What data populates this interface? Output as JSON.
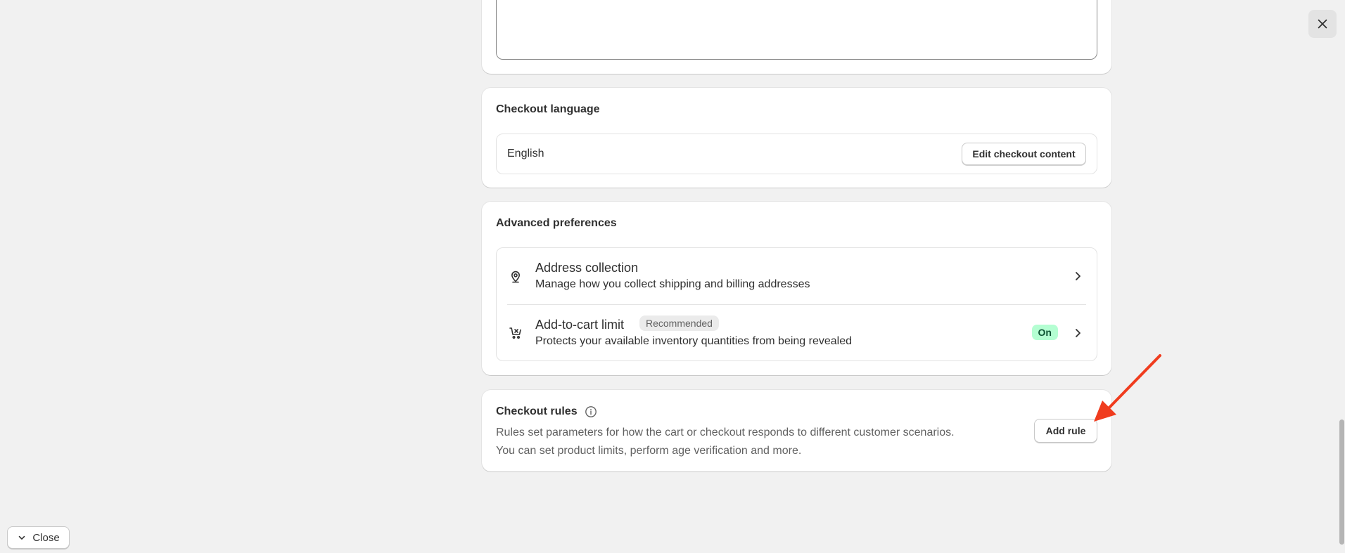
{
  "checkout_language": {
    "title": "Checkout language",
    "value": "English",
    "edit_button_label": "Edit checkout content"
  },
  "advanced_preferences": {
    "title": "Advanced preferences",
    "items": [
      {
        "icon": "location-pin-icon",
        "title": "Address collection",
        "description": "Manage how you collect shipping and billing addresses"
      },
      {
        "icon": "cart-limit-icon",
        "title": "Add-to-cart limit",
        "badge": "Recommended",
        "status": "On",
        "description": "Protects your available inventory quantities from being revealed"
      }
    ]
  },
  "checkout_rules": {
    "title": "Checkout rules",
    "description_line1": "Rules set parameters for how the cart or checkout responds to different customer scenarios.",
    "description_line2": "You can set product limits, perform age verification and more.",
    "add_button_label": "Add rule"
  },
  "footer": {
    "close_label": "Close"
  },
  "colors": {
    "background": "#f1f1f1",
    "card": "#ffffff",
    "on_badge": "#b4fed2",
    "annotation_arrow": "#f03c1e"
  }
}
